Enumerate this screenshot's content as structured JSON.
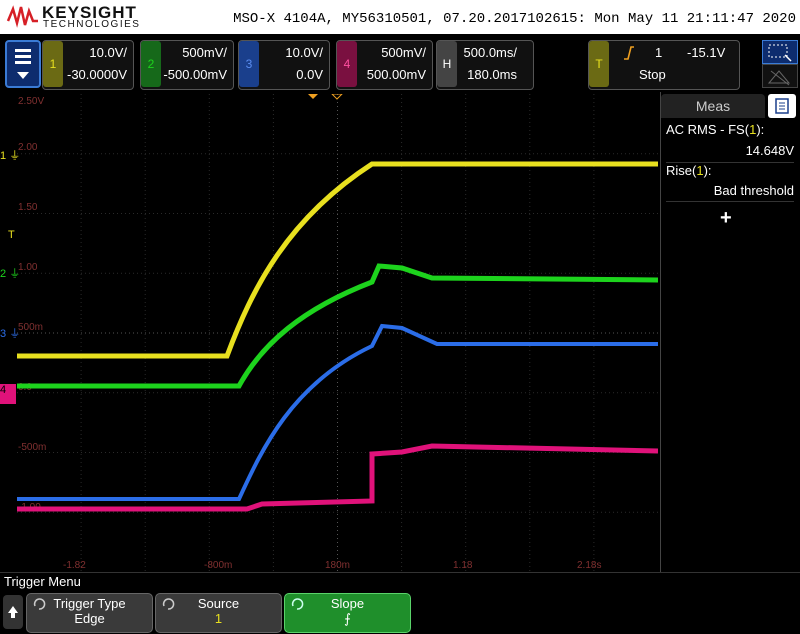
{
  "header": {
    "brand": "KEYSIGHT",
    "brand_sub": "TECHNOLOGIES",
    "title_info": "MSO-X 4104A, MY56310501, 07.20.2017102615: Mon May 11 21:11:47 2020"
  },
  "channels": [
    {
      "num": "1",
      "scale": "10.0V/",
      "offset": "-30.0000V",
      "color": "#e8e01f"
    },
    {
      "num": "2",
      "scale": "500mV/",
      "offset": "-500.00mV",
      "color": "#1dd31d"
    },
    {
      "num": "3",
      "scale": "10.0V/",
      "offset": "0.0V",
      "color": "#2b6de8"
    },
    {
      "num": "4",
      "scale": "500mV/",
      "offset": "500.00mV",
      "color": "#e0127a"
    }
  ],
  "horizontal": {
    "label": "H",
    "scale": "500.0ms/",
    "delay": "180.0ms"
  },
  "trigger": {
    "label": "T",
    "source": "1",
    "level": "-15.1V",
    "status": "Stop"
  },
  "meas": {
    "tab": "Meas",
    "items": [
      {
        "name": "AC RMS - FS",
        "src": "1",
        "value": "14.648V"
      },
      {
        "name": "Rise",
        "src": "1",
        "value": "Bad threshold"
      }
    ],
    "add_symbol": "+"
  },
  "grid": {
    "y_labels": [
      "2.50V",
      "2.00",
      "1.50",
      "1.00",
      "500m",
      "0.0",
      "-500m",
      "-1.00"
    ],
    "x_labels": [
      "-1.82",
      "-800m",
      "180m",
      "1.18",
      "2.18s"
    ]
  },
  "side_markers": {
    "ch1": "1",
    "trig": "T",
    "ch2": "2",
    "ch3": "3",
    "ch4": "4"
  },
  "bottom": {
    "menu_title": "Trigger Menu",
    "softkeys": [
      {
        "label": "Trigger Type",
        "value": "Edge"
      },
      {
        "label": "Source",
        "value": "1"
      },
      {
        "label": "Slope",
        "value": "⨍"
      }
    ]
  },
  "colors": {
    "ch1": "#e8e01f",
    "ch2": "#1dd31d",
    "ch3": "#2b6de8",
    "ch4": "#e0127a",
    "orange": "#f0a020"
  }
}
